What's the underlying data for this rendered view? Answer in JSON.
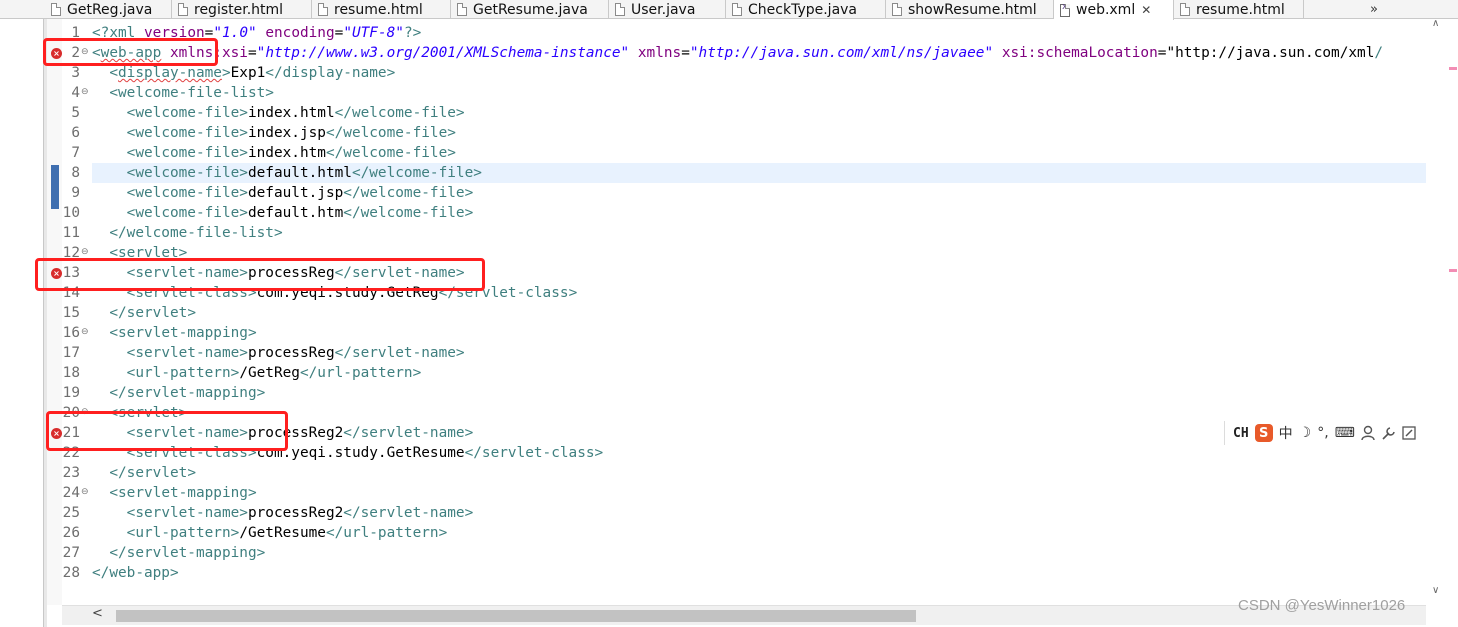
{
  "tabs": [
    {
      "label": "GetReg.java",
      "type": "file",
      "active": false
    },
    {
      "label": "register.html",
      "type": "file",
      "active": false
    },
    {
      "label": "resume.html",
      "type": "file",
      "active": false
    },
    {
      "label": "GetResume.java",
      "type": "file",
      "active": false
    },
    {
      "label": "User.java",
      "type": "file",
      "active": false
    },
    {
      "label": "CheckType.java",
      "type": "file",
      "active": false
    },
    {
      "label": "showResume.html",
      "type": "file",
      "active": false
    },
    {
      "label": "web.xml",
      "type": "xml",
      "active": true
    },
    {
      "label": "resume.html",
      "type": "file",
      "active": false
    }
  ],
  "tab_overflow": "»",
  "editor": {
    "current_line": 8,
    "error_lines": [
      2,
      13,
      21
    ],
    "folded_lines": [
      2,
      4,
      12,
      16,
      20,
      24
    ],
    "lines": [
      {
        "n": "1",
        "text": "<?xml version=\"1.0\" encoding=\"UTF-8\"?>"
      },
      {
        "n": "2",
        "text": "<web-app xmlns:xsi=\"http://www.w3.org/2001/XMLSchema-instance\" xmlns=\"http://java.sun.com/xml/ns/javaee\" xsi:schemaLocation=\"http://java.sun.com/xml/"
      },
      {
        "n": "3",
        "text": "  <display-name>Exp1</display-name>"
      },
      {
        "n": "4",
        "text": "  <welcome-file-list>"
      },
      {
        "n": "5",
        "text": "    <welcome-file>index.html</welcome-file>"
      },
      {
        "n": "6",
        "text": "    <welcome-file>index.jsp</welcome-file>"
      },
      {
        "n": "7",
        "text": "    <welcome-file>index.htm</welcome-file>"
      },
      {
        "n": "8",
        "text": "    <welcome-file>default.html</welcome-file>"
      },
      {
        "n": "9",
        "text": "    <welcome-file>default.jsp</welcome-file>"
      },
      {
        "n": "10",
        "text": "    <welcome-file>default.htm</welcome-file>"
      },
      {
        "n": "11",
        "text": "  </welcome-file-list>"
      },
      {
        "n": "12",
        "text": "  <servlet>"
      },
      {
        "n": "13",
        "text": "    <servlet-name>processReg</servlet-name>"
      },
      {
        "n": "14",
        "text": "    <servlet-class>com.yeqi.study.GetReg</servlet-class>"
      },
      {
        "n": "15",
        "text": "  </servlet>"
      },
      {
        "n": "16",
        "text": "  <servlet-mapping>"
      },
      {
        "n": "17",
        "text": "    <servlet-name>processReg</servlet-name>"
      },
      {
        "n": "18",
        "text": "    <url-pattern>/GetReg</url-pattern>"
      },
      {
        "n": "19",
        "text": "  </servlet-mapping>"
      },
      {
        "n": "20",
        "text": "  <servlet>"
      },
      {
        "n": "21",
        "text": "    <servlet-name>processReg2</servlet-name>"
      },
      {
        "n": "22",
        "text": "    <servlet-class>com.yeqi.study.GetResume</servlet-class>"
      },
      {
        "n": "23",
        "text": "  </servlet>"
      },
      {
        "n": "24",
        "text": "  <servlet-mapping>"
      },
      {
        "n": "25",
        "text": "    <servlet-name>processReg2</servlet-name>"
      },
      {
        "n": "26",
        "text": "    <url-pattern>/GetResume</url-pattern>"
      },
      {
        "n": "27",
        "text": "  </servlet-mapping>"
      },
      {
        "n": "28",
        "text": "</web-app>"
      }
    ]
  },
  "colors": {
    "tag": "#3f7f7f",
    "attribute_name": "#7f007f",
    "attribute_value": "#2a00ff",
    "text": "#000000",
    "current_line_bg": "#e8f2fe",
    "annotation_red": "#ff1f1f"
  },
  "ime_toolbar": {
    "items": [
      "CH",
      "S",
      "中",
      "moon-icon",
      "dot-icon",
      "keyboard-icon",
      "person-icon",
      "wrench-icon",
      "edit-icon"
    ]
  },
  "watermark": "CSDN @YesWinner1026"
}
